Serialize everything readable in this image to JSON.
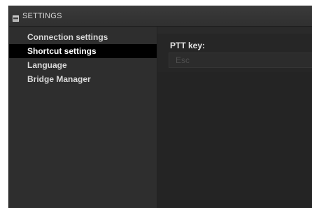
{
  "window": {
    "title": "SETTINGS",
    "title_icon": "settings-window-icon"
  },
  "sidebar": {
    "items": [
      {
        "label": "Connection settings",
        "active": false
      },
      {
        "label": "Shortcut settings",
        "active": true
      },
      {
        "label": "Language",
        "active": false
      },
      {
        "label": "Bridge Manager",
        "active": false
      }
    ]
  },
  "main": {
    "ptt": {
      "label": "PTT key:",
      "value": "Esc"
    }
  },
  "colors": {
    "sidebar_active_bg": "#000000",
    "window_bg": "#2b2b2b"
  }
}
